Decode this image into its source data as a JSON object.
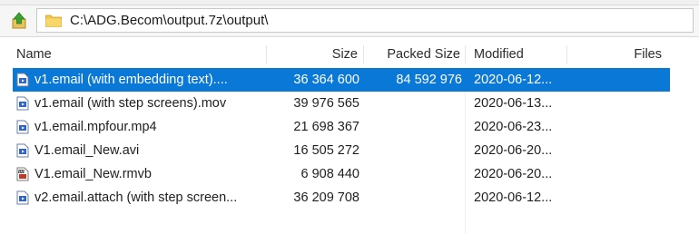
{
  "toolbar": {
    "up_icon": "folder-up-arrow-icon"
  },
  "address": {
    "path": "C:\\ADG.Becom\\output.7z\\output\\",
    "folder_icon": "folder-icon"
  },
  "columns": {
    "name": "Name",
    "size": "Size",
    "packed_size": "Packed Size",
    "modified": "Modified",
    "files": "Files"
  },
  "files": [
    {
      "name": "v1.email (with embedding text)....",
      "size": "36 364 600",
      "packed": "84 592 976",
      "modified": "2020-06-12...",
      "icon": "video-file-icon",
      "selected": true
    },
    {
      "name": "v1.email (with step screens).mov",
      "size": "39 976 565",
      "packed": "",
      "modified": "2020-06-13...",
      "icon": "video-file-icon",
      "selected": false
    },
    {
      "name": "v1.email.mpfour.mp4",
      "size": "21 698 367",
      "packed": "",
      "modified": "2020-06-23...",
      "icon": "video-file-icon",
      "selected": false
    },
    {
      "name": "V1.email_New.avi",
      "size": "16 505 272",
      "packed": "",
      "modified": "2020-06-20...",
      "icon": "video-file-icon",
      "selected": false
    },
    {
      "name": "V1.email_New.rmvb",
      "size": "6 908 440",
      "packed": "",
      "modified": "2020-06-20...",
      "icon": "media-clip-file-icon",
      "selected": false
    },
    {
      "name": "v2.email.attach (with step screen...",
      "size": "36 209 708",
      "packed": "",
      "modified": "2020-06-12...",
      "icon": "video-file-icon",
      "selected": false
    }
  ],
  "colors": {
    "selection": "#0a78d7",
    "up_arrow": "#3aa12f",
    "folder": "#e8b93a"
  }
}
